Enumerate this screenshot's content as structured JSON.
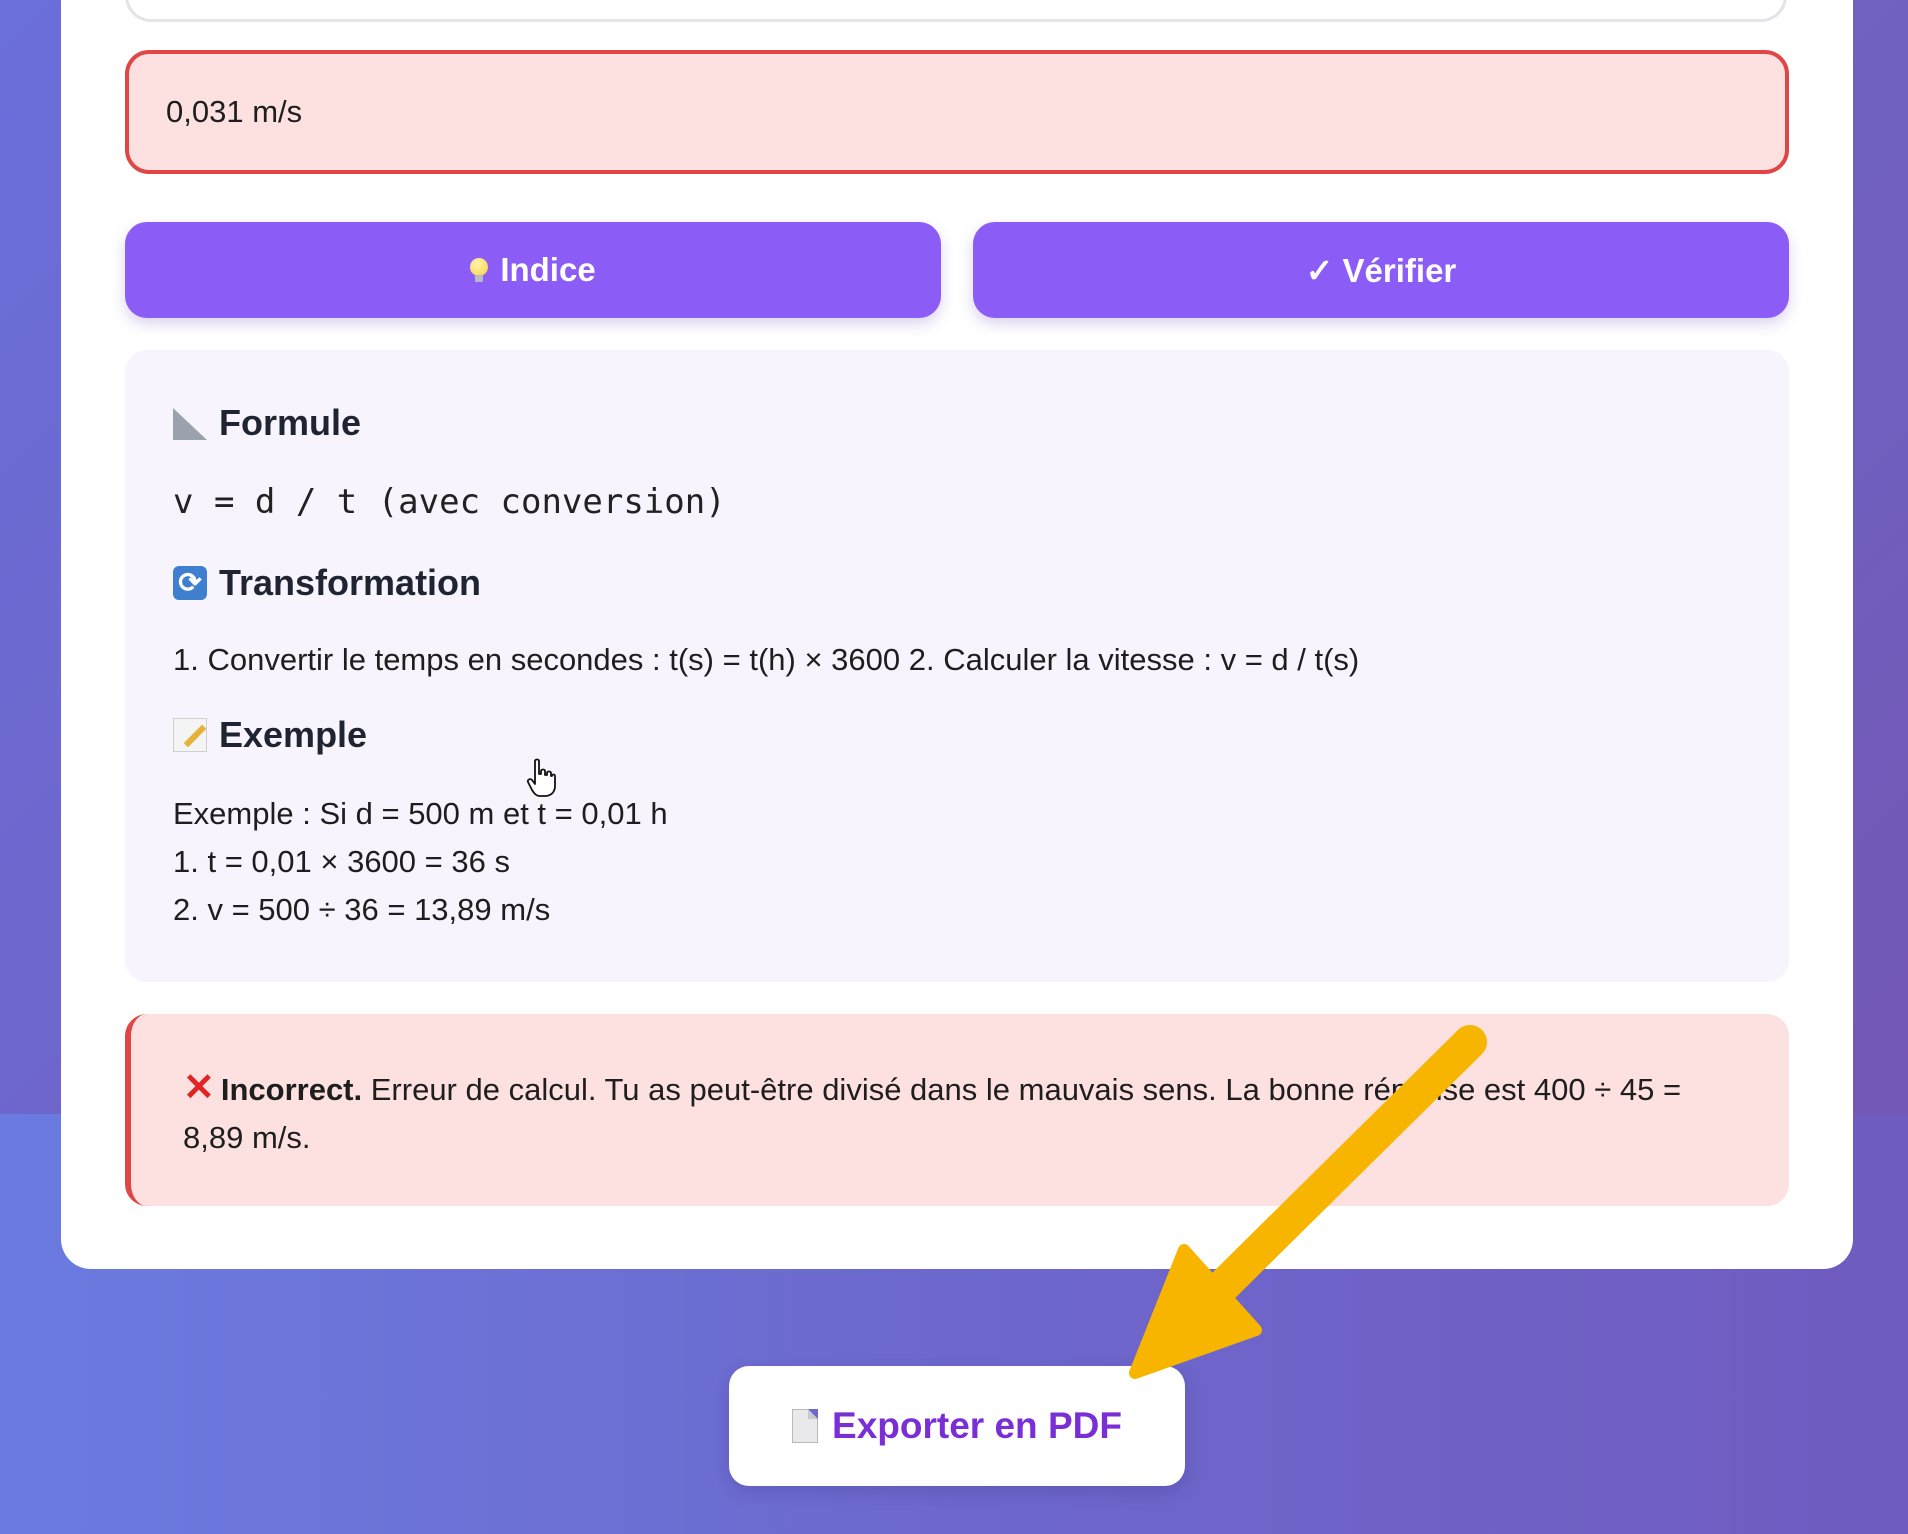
{
  "answer_field": {
    "value": "0,031 m/s"
  },
  "buttons": {
    "hint_label": "Indice",
    "verify_label": "✓ Vérifier"
  },
  "help": {
    "formula_title": "Formule",
    "formula": "v = d / t (avec conversion)",
    "transformation_title": "Transformation",
    "transformation": "1. Convertir le temps en secondes : t(s) = t(h) × 3600 2. Calculer la vitesse : v = d / t(s)",
    "example_title": "Exemple",
    "example_lines": [
      "Exemple : Si d = 500 m et t = 0,01 h",
      "1. t = 0,01 × 3600 = 36 s",
      "2. v = 500 ÷ 36 = 13,89 m/s"
    ]
  },
  "feedback": {
    "status": "Incorrect.",
    "message": "Erreur de calcul. Tu as peut-être divisé dans le mauvais sens. La bonne réponse est 400 ÷ 45 = 8,89 m/s."
  },
  "export": {
    "label": "Exporter en PDF"
  },
  "colors": {
    "accent": "#8b5cf6",
    "error": "#e04646",
    "error_bg": "#fde1e1",
    "panel_bg": "#f8f4fe",
    "export_text": "#7a2fd6",
    "annotation_arrow": "#f7b500"
  },
  "icons": {
    "hint": "light-bulb-icon",
    "formula": "triangle-ruler-icon",
    "transformation": "arrows-cycle-icon",
    "example": "memo-icon",
    "feedback": "cross-mark-icon",
    "export": "document-icon"
  }
}
